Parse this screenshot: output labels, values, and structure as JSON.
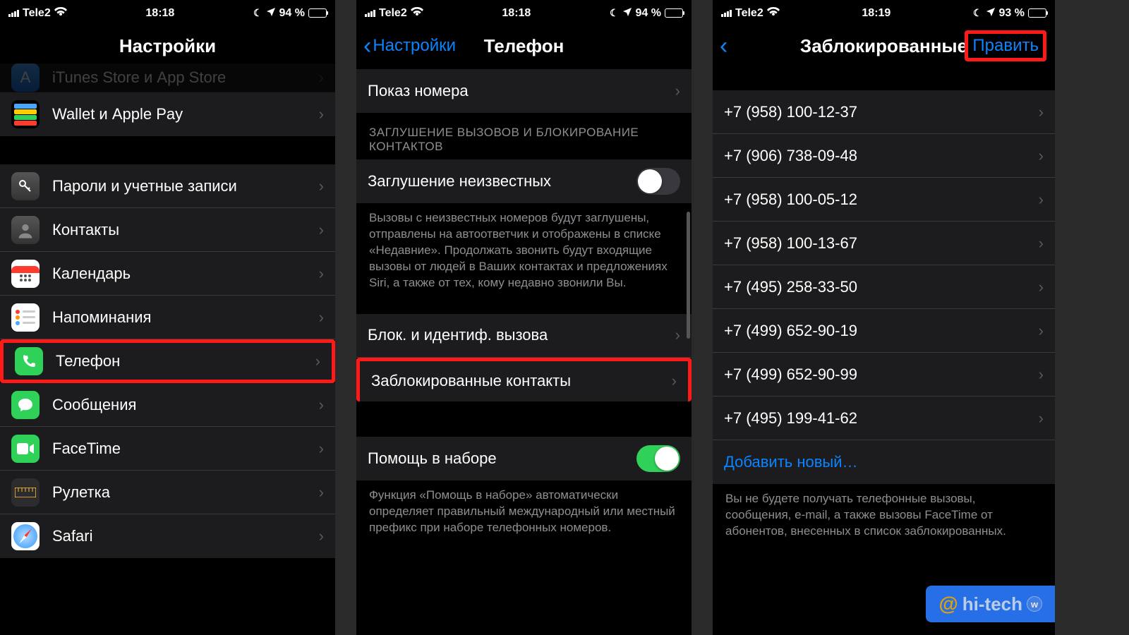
{
  "screens": {
    "s1": {
      "status": {
        "carrier": "Tele2",
        "time": "18:18",
        "battery_pct": "94 %",
        "battery_fill": 94
      },
      "nav": {
        "title": "Настройки"
      },
      "item_appstore": "iTunes Store и App Store",
      "item_wallet": "Wallet и Apple Pay",
      "item_passwords": "Пароли и учетные записи",
      "item_contacts": "Контакты",
      "item_calendar": "Календарь",
      "item_reminders": "Напоминания",
      "item_phone": "Телефон",
      "item_messages": "Сообщения",
      "item_facetime": "FaceTime",
      "item_ruler": "Рулетка",
      "item_safari": "Safari"
    },
    "s2": {
      "status": {
        "carrier": "Tele2",
        "time": "18:18",
        "battery_pct": "94 %",
        "battery_fill": 94
      },
      "nav": {
        "back": "Настройки",
        "title": "Телефон"
      },
      "item_callerid": "Показ номера",
      "hdr_silence": "ЗАГЛУШЕНИЕ ВЫЗОВОВ И БЛОКИРОВАНИЕ КОНТАКТОВ",
      "item_silence": "Заглушение неизвестных",
      "ftr_silence": "Вызовы с неизвестных номеров будут заглушены, отправлены на автоответчик и отображены в списке «Недавние». Продолжать звонить будут входящие вызовы от людей в Ваших контактах и предложениях Siri, а также от тех, кому недавно звонили Вы.",
      "item_blockid": "Блок. и идентиф. вызова",
      "item_blocked": "Заблокированные контакты",
      "item_dialassist": "Помощь в наборе",
      "ftr_dialassist": "Функция «Помощь в наборе» автоматически определяет правильный международный или местный префикс при наборе телефонных номеров."
    },
    "s3": {
      "status": {
        "carrier": "Tele2",
        "time": "18:19",
        "battery_pct": "93 %",
        "battery_fill": 93
      },
      "nav": {
        "title": "Заблокированные",
        "edit": "Править"
      },
      "numbers": [
        "+7 (958) 100-12-37",
        "+7 (906) 738-09-48",
        "+7 (958) 100-05-12",
        "+7 (958) 100-13-67",
        "+7 (495) 258-33-50",
        "+7 (499) 652-90-19",
        "+7 (499) 652-90-99",
        "+7 (495) 199-41-62"
      ],
      "add_new": "Добавить новый…",
      "ftr": "Вы не будете получать телефонные вызовы, сообщения, e-mail, а также вызовы FaceTime от абонентов, внесенных в список заблокированных."
    }
  },
  "watermark": "hi-tech"
}
